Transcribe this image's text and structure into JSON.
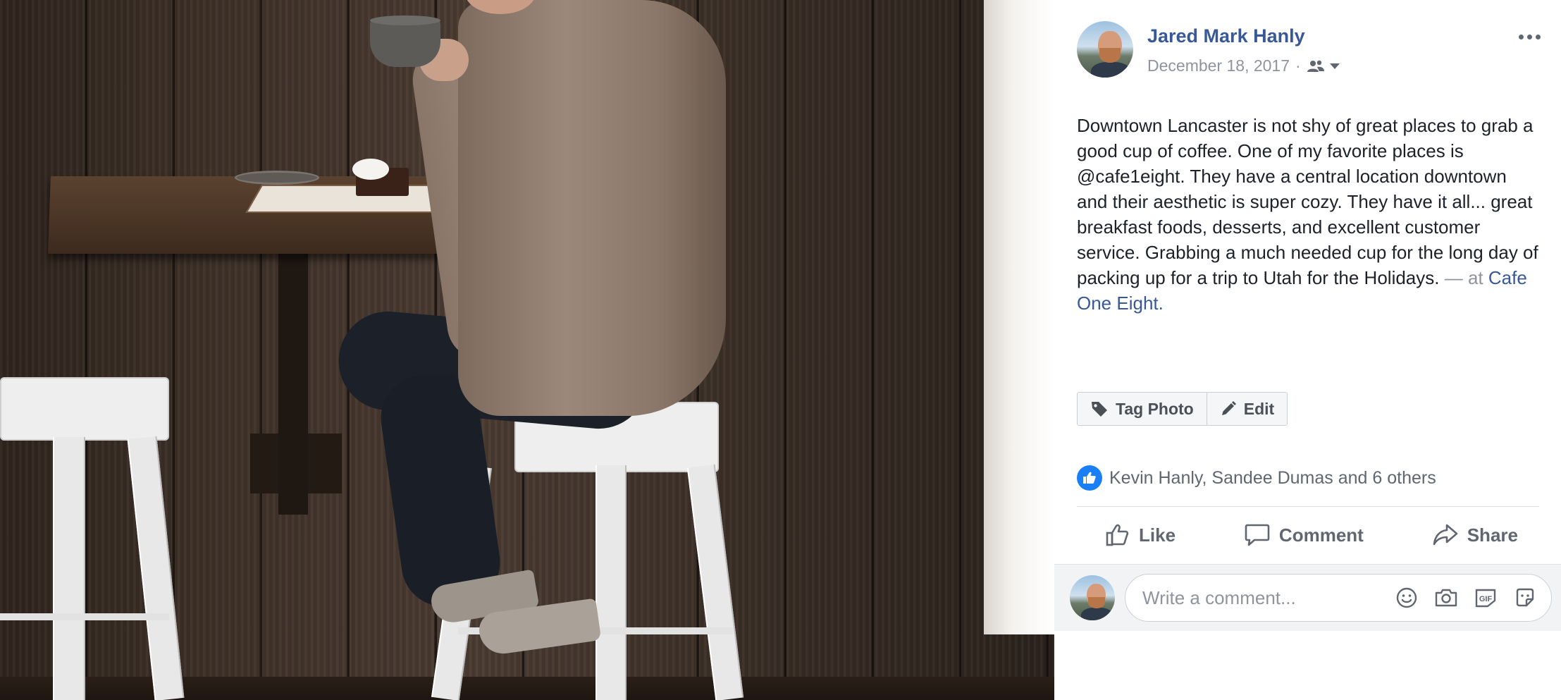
{
  "photo": {
    "alt_icon": "photo-of-man-drinking-coffee"
  },
  "post": {
    "author": "Jared Mark Hanly",
    "date": "December 18, 2017",
    "separator": "·",
    "audience_icon": "friends-icon",
    "text": "Downtown Lancaster is not shy of great places to grab a good cup of coffee. One of my favorite places is @cafe1eight. They have a central location downtown and their aesthetic is super cozy. They have it all... great breakfast foods, desserts, and excellent customer service. Grabbing a much needed cup for the long day of packing up for a trip to Utah for the Holidays.",
    "at_label": " — at ",
    "place": "Cafe One Eight."
  },
  "photo_actions": {
    "tag_label": "Tag Photo",
    "edit_label": "Edit"
  },
  "reactions": {
    "summary": "Kevin Hanly, Sandee Dumas and 6 others"
  },
  "actions": {
    "like": "Like",
    "comment": "Comment",
    "share": "Share"
  },
  "comment": {
    "placeholder": "Write a comment..."
  },
  "colors": {
    "link": "#385898",
    "muted": "#90949c",
    "like_blue": "#1a7ef5",
    "text": "#1d2129"
  }
}
